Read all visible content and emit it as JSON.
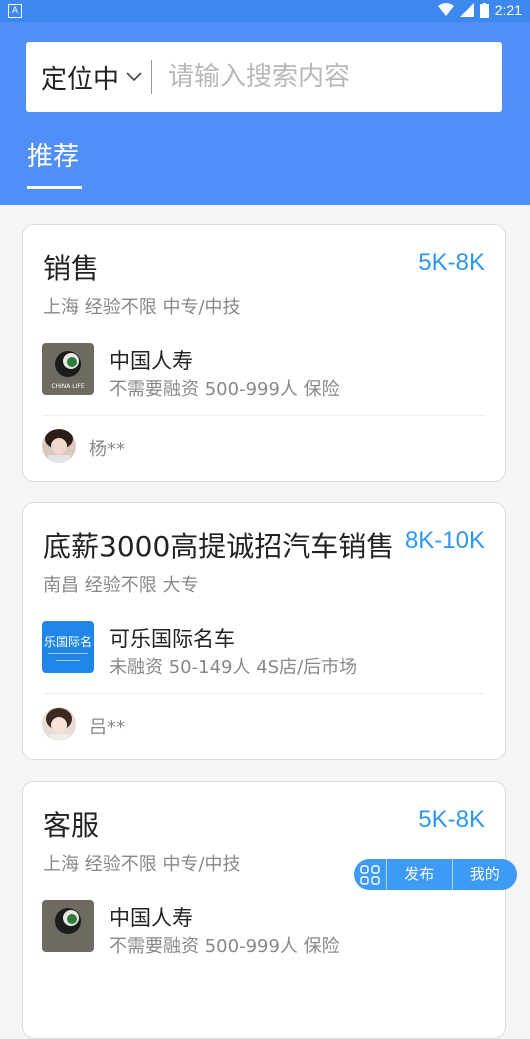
{
  "status_bar": {
    "time": "2:21"
  },
  "search": {
    "location_label": "定位中",
    "placeholder": "请输入搜索内容",
    "value": ""
  },
  "tabs": {
    "active": "推荐"
  },
  "jobs": [
    {
      "title": "销售",
      "salary": "5K-8K",
      "meta": "上海 经验不限 中专/中技",
      "company": "中国人寿",
      "company_info": "不需要融资 500-999人 保险",
      "recruiter": "杨**",
      "logo_text": "CHINA LIFE"
    },
    {
      "title": "底薪3000高提诚招汽车销售",
      "salary": "8K-10K",
      "meta": "南昌 经验不限 大专",
      "company": "可乐国际名车",
      "company_info": "未融资 50-149人 4S店/后市场",
      "recruiter": "吕**",
      "logo_text": "乐国际名"
    },
    {
      "title": "客服",
      "salary": "5K-8K",
      "meta": "上海 经验不限 中专/中技",
      "company": "中国人寿",
      "company_info": "不需要融资 500-999人 保险",
      "recruiter": "",
      "logo_text": ""
    }
  ],
  "fab": {
    "publish": "发布",
    "mine": "我的"
  },
  "colors": {
    "header": "#4f8ff7",
    "salary": "#2d97f0",
    "fab": "#3d9af5"
  }
}
